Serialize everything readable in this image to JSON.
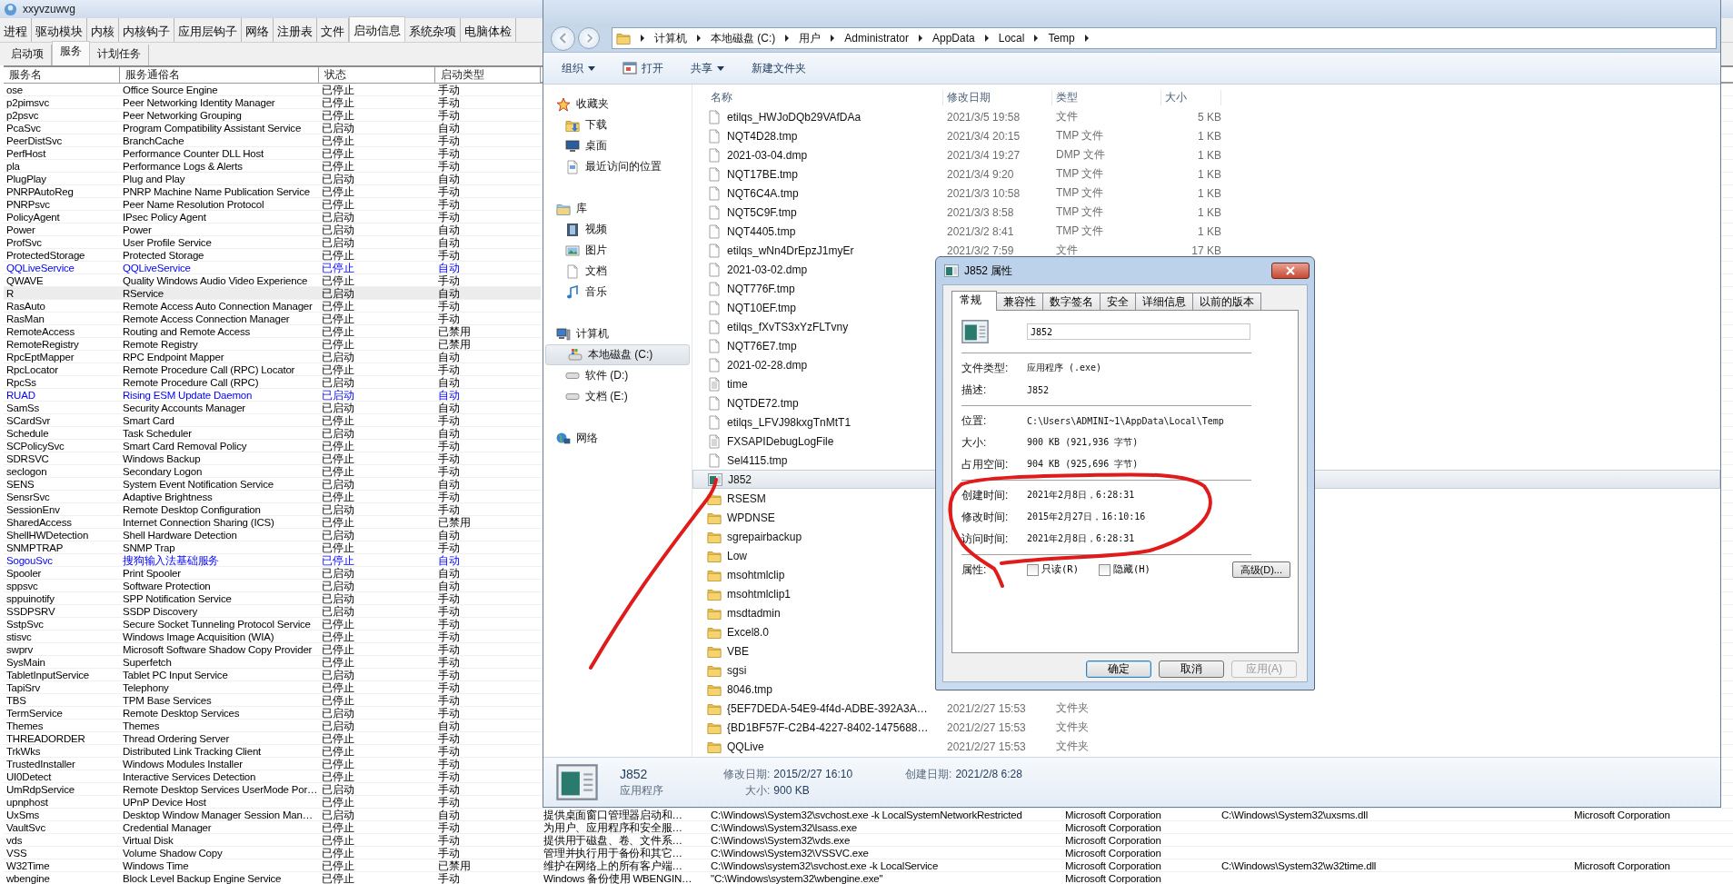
{
  "services_app": {
    "title": "xxyvzuwvg",
    "tabs": [
      {
        "label": "进程",
        "selected": false
      },
      {
        "label": "驱动模块",
        "selected": false
      },
      {
        "label": "内核",
        "selected": false
      },
      {
        "label": "内核钩子",
        "selected": false
      },
      {
        "label": "应用层钩子",
        "selected": false
      },
      {
        "label": "网络",
        "selected": false
      },
      {
        "label": "注册表",
        "selected": false
      },
      {
        "label": "文件",
        "selected": false
      },
      {
        "label": "启动信息",
        "selected": true
      },
      {
        "label": "系统杂项",
        "selected": false
      },
      {
        "label": "电脑体检",
        "selected": false
      }
    ],
    "subtabs": [
      {
        "label": "启动项",
        "selected": false
      },
      {
        "label": "服务",
        "selected": true
      },
      {
        "label": "计划任务",
        "selected": false
      }
    ],
    "table": {
      "columns": [
        "服务名",
        "服务通俗名",
        "状态",
        "启动类型"
      ],
      "rows": [
        {
          "cells": [
            "ose",
            "Office Source Engine",
            "已停止",
            "手动"
          ],
          "highlighted": false,
          "selected": false
        },
        {
          "cells": [
            "p2pimsvc",
            "Peer Networking Identity Manager",
            "已停止",
            "手动"
          ],
          "highlighted": false,
          "selected": false
        },
        {
          "cells": [
            "p2psvc",
            "Peer Networking Grouping",
            "已停止",
            "手动"
          ],
          "highlighted": false,
          "selected": false
        },
        {
          "cells": [
            "PcaSvc",
            "Program Compatibility Assistant Service",
            "已启动",
            "自动"
          ],
          "highlighted": false,
          "selected": false
        },
        {
          "cells": [
            "PeerDistSvc",
            "BranchCache",
            "已停止",
            "手动"
          ],
          "highlighted": false,
          "selected": false
        },
        {
          "cells": [
            "PerfHost",
            "Performance Counter DLL Host",
            "已停止",
            "手动"
          ],
          "highlighted": false,
          "selected": false
        },
        {
          "cells": [
            "pla",
            "Performance Logs & Alerts",
            "已停止",
            "手动"
          ],
          "highlighted": false,
          "selected": false
        },
        {
          "cells": [
            "PlugPlay",
            "Plug and Play",
            "已启动",
            "自动"
          ],
          "highlighted": false,
          "selected": false
        },
        {
          "cells": [
            "PNRPAutoReg",
            "PNRP Machine Name Publication Service",
            "已停止",
            "手动"
          ],
          "highlighted": false,
          "selected": false
        },
        {
          "cells": [
            "PNRPsvc",
            "Peer Name Resolution Protocol",
            "已停止",
            "手动"
          ],
          "highlighted": false,
          "selected": false
        },
        {
          "cells": [
            "PolicyAgent",
            "IPsec Policy Agent",
            "已启动",
            "手动"
          ],
          "highlighted": false,
          "selected": false
        },
        {
          "cells": [
            "Power",
            "Power",
            "已启动",
            "自动"
          ],
          "highlighted": false,
          "selected": false
        },
        {
          "cells": [
            "ProfSvc",
            "User Profile Service",
            "已启动",
            "自动"
          ],
          "highlighted": false,
          "selected": false
        },
        {
          "cells": [
            "ProtectedStorage",
            "Protected Storage",
            "已停止",
            "手动"
          ],
          "highlighted": false,
          "selected": false
        },
        {
          "cells": [
            "QQLiveService",
            "QQLiveService",
            "已停止",
            "自动"
          ],
          "highlighted": true,
          "selected": false
        },
        {
          "cells": [
            "QWAVE",
            "Quality Windows Audio Video Experience",
            "已停止",
            "手动"
          ],
          "highlighted": false,
          "selected": false
        },
        {
          "cells": [
            "R",
            "RService",
            "已启动",
            "自动"
          ],
          "highlighted": false,
          "selected": true
        },
        {
          "cells": [
            "RasAuto",
            "Remote Access Auto Connection Manager",
            "已停止",
            "手动"
          ],
          "highlighted": false,
          "selected": false
        },
        {
          "cells": [
            "RasMan",
            "Remote Access Connection Manager",
            "已停止",
            "手动"
          ],
          "highlighted": false,
          "selected": false
        },
        {
          "cells": [
            "RemoteAccess",
            "Routing and Remote Access",
            "已停止",
            "已禁用"
          ],
          "highlighted": false,
          "selected": false
        },
        {
          "cells": [
            "RemoteRegistry",
            "Remote Registry",
            "已停止",
            "已禁用"
          ],
          "highlighted": false,
          "selected": false
        },
        {
          "cells": [
            "RpcEptMapper",
            "RPC Endpoint Mapper",
            "已启动",
            "自动"
          ],
          "highlighted": false,
          "selected": false
        },
        {
          "cells": [
            "RpcLocator",
            "Remote Procedure Call (RPC) Locator",
            "已停止",
            "手动"
          ],
          "highlighted": false,
          "selected": false
        },
        {
          "cells": [
            "RpcSs",
            "Remote Procedure Call (RPC)",
            "已启动",
            "自动"
          ],
          "highlighted": false,
          "selected": false
        },
        {
          "cells": [
            "RUAD",
            "Rising ESM Update Daemon",
            "已启动",
            "自动"
          ],
          "highlighted": true,
          "selected": false
        },
        {
          "cells": [
            "SamSs",
            "Security Accounts Manager",
            "已启动",
            "自动"
          ],
          "highlighted": false,
          "selected": false
        },
        {
          "cells": [
            "SCardSvr",
            "Smart Card",
            "已停止",
            "手动"
          ],
          "highlighted": false,
          "selected": false
        },
        {
          "cells": [
            "Schedule",
            "Task Scheduler",
            "已启动",
            "自动"
          ],
          "highlighted": false,
          "selected": false
        },
        {
          "cells": [
            "SCPolicySvc",
            "Smart Card Removal Policy",
            "已停止",
            "手动"
          ],
          "highlighted": false,
          "selected": false
        },
        {
          "cells": [
            "SDRSVC",
            "Windows Backup",
            "已停止",
            "手动"
          ],
          "highlighted": false,
          "selected": false
        },
        {
          "cells": [
            "seclogon",
            "Secondary Logon",
            "已停止",
            "手动"
          ],
          "highlighted": false,
          "selected": false
        },
        {
          "cells": [
            "SENS",
            "System Event Notification Service",
            "已启动",
            "自动"
          ],
          "highlighted": false,
          "selected": false
        },
        {
          "cells": [
            "SensrSvc",
            "Adaptive Brightness",
            "已停止",
            "手动"
          ],
          "highlighted": false,
          "selected": false
        },
        {
          "cells": [
            "SessionEnv",
            "Remote Desktop Configuration",
            "已启动",
            "手动"
          ],
          "highlighted": false,
          "selected": false
        },
        {
          "cells": [
            "SharedAccess",
            "Internet Connection Sharing (ICS)",
            "已停止",
            "已禁用"
          ],
          "highlighted": false,
          "selected": false
        },
        {
          "cells": [
            "ShellHWDetection",
            "Shell Hardware Detection",
            "已启动",
            "自动"
          ],
          "highlighted": false,
          "selected": false
        },
        {
          "cells": [
            "SNMPTRAP",
            "SNMP Trap",
            "已停止",
            "手动"
          ],
          "highlighted": false,
          "selected": false
        },
        {
          "cells": [
            "SogouSvc",
            "搜狗输入法基础服务",
            "已停止",
            "自动"
          ],
          "highlighted": true,
          "selected": false
        },
        {
          "cells": [
            "Spooler",
            "Print Spooler",
            "已启动",
            "自动"
          ],
          "highlighted": false,
          "selected": false
        },
        {
          "cells": [
            "sppsvc",
            "Software Protection",
            "已启动",
            "自动"
          ],
          "highlighted": false,
          "selected": false
        },
        {
          "cells": [
            "sppuinotify",
            "SPP Notification Service",
            "已启动",
            "手动"
          ],
          "highlighted": false,
          "selected": false
        },
        {
          "cells": [
            "SSDPSRV",
            "SSDP Discovery",
            "已启动",
            "手动"
          ],
          "highlighted": false,
          "selected": false
        },
        {
          "cells": [
            "SstpSvc",
            "Secure Socket Tunneling Protocol Service",
            "已停止",
            "手动"
          ],
          "highlighted": false,
          "selected": false
        },
        {
          "cells": [
            "stisvc",
            "Windows Image Acquisition (WIA)",
            "已停止",
            "手动"
          ],
          "highlighted": false,
          "selected": false
        },
        {
          "cells": [
            "swprv",
            "Microsoft Software Shadow Copy Provider",
            "已停止",
            "手动"
          ],
          "highlighted": false,
          "selected": false
        },
        {
          "cells": [
            "SysMain",
            "Superfetch",
            "已停止",
            "手动"
          ],
          "highlighted": false,
          "selected": false
        },
        {
          "cells": [
            "TabletInputService",
            "Tablet PC Input Service",
            "已启动",
            "手动"
          ],
          "highlighted": false,
          "selected": false
        },
        {
          "cells": [
            "TapiSrv",
            "Telephony",
            "已停止",
            "手动"
          ],
          "highlighted": false,
          "selected": false
        },
        {
          "cells": [
            "TBS",
            "TPM Base Services",
            "已停止",
            "手动"
          ],
          "highlighted": false,
          "selected": false
        },
        {
          "cells": [
            "TermService",
            "Remote Desktop Services",
            "已启动",
            "手动"
          ],
          "highlighted": false,
          "selected": false
        },
        {
          "cells": [
            "Themes",
            "Themes",
            "已启动",
            "自动"
          ],
          "highlighted": false,
          "selected": false
        },
        {
          "cells": [
            "THREADORDER",
            "Thread Ordering Server",
            "已停止",
            "手动"
          ],
          "highlighted": false,
          "selected": false
        },
        {
          "cells": [
            "TrkWks",
            "Distributed Link Tracking Client",
            "已停止",
            "手动"
          ],
          "highlighted": false,
          "selected": false
        },
        {
          "cells": [
            "TrustedInstaller",
            "Windows Modules Installer",
            "已停止",
            "手动"
          ],
          "highlighted": false,
          "selected": false
        },
        {
          "cells": [
            "UI0Detect",
            "Interactive Services Detection",
            "已停止",
            "手动"
          ],
          "highlighted": false,
          "selected": false
        },
        {
          "cells": [
            "UmRdpService",
            "Remote Desktop Services UserMode Por…",
            "已启动",
            "手动"
          ],
          "highlighted": false,
          "selected": false
        },
        {
          "cells": [
            "upnphost",
            "UPnP Device Host",
            "已停止",
            "手动"
          ],
          "highlighted": false,
          "selected": false
        },
        {
          "cells": [
            "UxSms",
            "Desktop Window Manager Session Man…",
            "已启动",
            "自动"
          ],
          "highlighted": false,
          "selected": false,
          "extra": [
            "提供桌面窗口管理器启动和…",
            "C:\\Windows\\System32\\svchost.exe -k LocalSystemNetworkRestricted",
            "Microsoft Corporation",
            "C:\\Windows\\System32\\uxsms.dll",
            "Microsoft Corporation"
          ]
        },
        {
          "cells": [
            "VaultSvc",
            "Credential Manager",
            "已停止",
            "手动"
          ],
          "highlighted": false,
          "selected": false,
          "extra": [
            "为用户、应用程序和安全服…",
            "C:\\Windows\\System32\\lsass.exe",
            "Microsoft Corporation"
          ]
        },
        {
          "cells": [
            "vds",
            "Virtual Disk",
            "已停止",
            "手动"
          ],
          "highlighted": false,
          "selected": false,
          "extra": [
            "提供用于磁盘、卷、文件系…",
            "C:\\Windows\\System32\\vds.exe",
            "Microsoft Corporation"
          ]
        },
        {
          "cells": [
            "VSS",
            "Volume Shadow Copy",
            "已停止",
            "手动"
          ],
          "highlighted": false,
          "selected": false,
          "extra": [
            "管理并执行用于备份和其它…",
            "C:\\Windows\\System32\\VSSVC.exe",
            "Microsoft Corporation"
          ]
        },
        {
          "cells": [
            "W32Time",
            "Windows Time",
            "已停止",
            "已禁用"
          ],
          "highlighted": false,
          "selected": false,
          "extra": [
            "维护在网络上的所有客户端…",
            "C:\\Windows\\system32\\svchost.exe -k LocalService",
            "Microsoft Corporation",
            "C:\\Windows\\System32\\w32time.dll",
            "Microsoft Corporation"
          ]
        },
        {
          "cells": [
            "wbengine",
            "Block Level Backup Engine Service",
            "已停止",
            "手动"
          ],
          "highlighted": false,
          "selected": false,
          "extra": [
            "Windows 备份使用 WBENGIN…",
            "\"C:\\Windows\\system32\\wbengine.exe\"",
            "Microsoft Corporation"
          ]
        }
      ]
    }
  },
  "explorer": {
    "breadcrumb": [
      "计算机",
      "本地磁盘 (C:)",
      "用户",
      "Administrator",
      "AppData",
      "Local",
      "Temp"
    ],
    "toolbar": [
      {
        "label": "组织",
        "kind": "menu"
      },
      {
        "label": "打开",
        "kind": "icon"
      },
      {
        "label": "共享",
        "kind": "menu"
      },
      {
        "label": "新建文件夹",
        "kind": "plain"
      }
    ],
    "nav": [
      {
        "label": "收藏夹",
        "selected": false,
        "children": [
          {
            "label": "下载",
            "selected": false
          },
          {
            "label": "桌面",
            "selected": false
          },
          {
            "label": "最近访问的位置",
            "selected": false
          }
        ]
      },
      {
        "label": "库",
        "selected": false,
        "children": [
          {
            "label": "视频",
            "selected": false
          },
          {
            "label": "图片",
            "selected": false
          },
          {
            "label": "文档",
            "selected": false
          },
          {
            "label": "音乐",
            "selected": false
          }
        ]
      },
      {
        "label": "计算机",
        "selected": false,
        "children": [
          {
            "label": "本地磁盘 (C:)",
            "selected": true
          },
          {
            "label": "软件 (D:)",
            "selected": false
          },
          {
            "label": "文档 (E:)",
            "selected": false
          }
        ]
      },
      {
        "label": "网络",
        "selected": false
      }
    ],
    "columns": [
      "名称",
      "修改日期",
      "类型",
      "大小"
    ],
    "files": [
      {
        "name": "etilqs_HWJoDQb29VAfDAa",
        "date": "2021/3/5 19:58",
        "type": "文件",
        "size": "5 KB",
        "kind": "blank",
        "selected": false
      },
      {
        "name": "NQT4D28.tmp",
        "date": "2021/3/4 20:15",
        "type": "TMP 文件",
        "size": "1 KB",
        "kind": "file",
        "selected": false
      },
      {
        "name": "2021-03-04.dmp",
        "date": "2021/3/4 19:27",
        "type": "DMP 文件",
        "size": "1 KB",
        "kind": "file",
        "selected": false
      },
      {
        "name": "NQT17BE.tmp",
        "date": "2021/3/4 9:20",
        "type": "TMP 文件",
        "size": "1 KB",
        "kind": "file",
        "selected": false
      },
      {
        "name": "NQT6C4A.tmp",
        "date": "2021/3/3 10:58",
        "type": "TMP 文件",
        "size": "1 KB",
        "kind": "file",
        "selected": false
      },
      {
        "name": "NQT5C9F.tmp",
        "date": "2021/3/3 8:58",
        "type": "TMP 文件",
        "size": "1 KB",
        "kind": "file",
        "selected": false
      },
      {
        "name": "NQT4405.tmp",
        "date": "2021/3/2 8:41",
        "type": "TMP 文件",
        "size": "1 KB",
        "kind": "file",
        "selected": false
      },
      {
        "name": "etilqs_wNn4DrEpzJ1myEr",
        "date": "2021/3/2 7:59",
        "type": "文件",
        "size": "17 KB",
        "kind": "blank",
        "selected": false
      },
      {
        "name": "2021-03-02.dmp",
        "kind": "file",
        "selected": false
      },
      {
        "name": "NQT776F.tmp",
        "kind": "file",
        "selected": false
      },
      {
        "name": "NQT10EF.tmp",
        "kind": "file",
        "selected": false
      },
      {
        "name": "etilqs_fXvTS3xYzFLTvny",
        "kind": "blank",
        "selected": false
      },
      {
        "name": "NQT76E7.tmp",
        "kind": "file",
        "selected": false
      },
      {
        "name": "2021-02-28.dmp",
        "kind": "file",
        "selected": false
      },
      {
        "name": "time",
        "kind": "text",
        "selected": false
      },
      {
        "name": "NQTDE72.tmp",
        "kind": "file",
        "selected": false
      },
      {
        "name": "etilqs_LFVJ98kxgTnMtT1",
        "kind": "blank",
        "selected": false
      },
      {
        "name": "FXSAPIDebugLogFile",
        "kind": "text",
        "selected": false
      },
      {
        "name": "Sel4115.tmp",
        "kind": "file",
        "selected": false
      },
      {
        "name": "J852",
        "kind": "app",
        "selected": true
      },
      {
        "name": "RSESM",
        "kind": "folder",
        "selected": false
      },
      {
        "name": "WPDNSE",
        "kind": "folder",
        "selected": false
      },
      {
        "name": "sgrepairbackup",
        "kind": "folder",
        "selected": false
      },
      {
        "name": "Low",
        "kind": "folder",
        "selected": false
      },
      {
        "name": "msohtmlclip",
        "kind": "folder",
        "selected": false
      },
      {
        "name": "msohtmlclip1",
        "kind": "folder",
        "selected": false
      },
      {
        "name": "msdtadmin",
        "kind": "folder",
        "selected": false
      },
      {
        "name": "Excel8.0",
        "kind": "folder",
        "selected": false
      },
      {
        "name": "VBE",
        "kind": "folder",
        "selected": false
      },
      {
        "name": "sgsi",
        "kind": "folder",
        "selected": false
      },
      {
        "name": "8046.tmp",
        "kind": "folder",
        "selected": false
      },
      {
        "name": "{5EF7DEDA-54E9-4f4d-ADBE-392A3A…",
        "date": "2021/2/27 15:53",
        "type": "文件夹",
        "kind": "folder",
        "selected": false
      },
      {
        "name": "{BD1BF57F-C2B4-4227-8402-1475688…",
        "date": "2021/2/27 15:53",
        "type": "文件夹",
        "kind": "folder",
        "selected": false
      },
      {
        "name": "QQLive",
        "date": "2021/2/27 15:53",
        "type": "文件夹",
        "kind": "folder",
        "selected": false
      }
    ],
    "details": {
      "name": "J852",
      "type": "应用程序",
      "modified_label": "修改日期:",
      "modified": "2015/2/27 16:10",
      "size_label": "大小:",
      "size": "900 KB",
      "created_label": "创建日期:",
      "created": "2021/2/8 6:28"
    }
  },
  "properties_dialog": {
    "title": "J852 属性",
    "tabs": [
      {
        "label": "常规",
        "selected": true
      },
      {
        "label": "兼容性",
        "selected": false
      },
      {
        "label": "数字签名",
        "selected": false
      },
      {
        "label": "安全",
        "selected": false
      },
      {
        "label": "详细信息",
        "selected": false
      },
      {
        "label": "以前的版本",
        "selected": false
      }
    ],
    "name_field": "J852",
    "sections": [
      [
        {
          "label": "文件类型:",
          "value": "应用程序 (.exe)"
        },
        {
          "label": "描述:",
          "value": "J852"
        }
      ],
      [
        {
          "label": "位置:",
          "value": "C:\\Users\\ADMINI~1\\AppData\\Local\\Temp"
        },
        {
          "label": "大小:",
          "value": "900 KB (921,936 字节)"
        },
        {
          "label": "占用空间:",
          "value": "904 KB (925,696 字节)"
        }
      ],
      [
        {
          "label": "创建时间:",
          "value": "2021年2月8日，6:28:31"
        },
        {
          "label": "修改时间:",
          "value": "2015年2月27日，16:10:16"
        },
        {
          "label": "访问时间:",
          "value": "2021年2月8日，6:28:31"
        }
      ]
    ],
    "attributes": {
      "label": "属性:",
      "checkboxes": [
        {
          "label": "只读(R)",
          "checked": false
        },
        {
          "label": "隐藏(H)",
          "checked": false
        }
      ],
      "advanced": "高级(D)..."
    },
    "buttons": [
      {
        "label": "确定",
        "kind": "default",
        "disabled": false
      },
      {
        "label": "取消",
        "kind": "normal",
        "disabled": false
      },
      {
        "label": "应用(A)",
        "kind": "normal",
        "disabled": true
      }
    ]
  }
}
